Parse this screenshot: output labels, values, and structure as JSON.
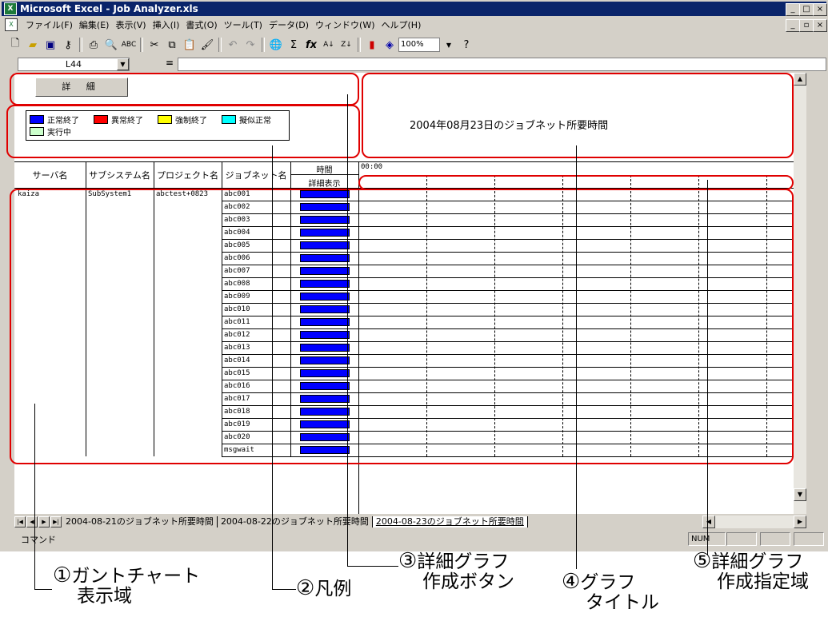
{
  "window": {
    "title": "Microsoft Excel - Job Analyzer.xls",
    "app_icon": "excel-icon",
    "doc_icon": "worksheet-icon"
  },
  "menu": [
    "ファイル(F)",
    "編集(E)",
    "表示(V)",
    "挿入(I)",
    "書式(O)",
    "ツール(T)",
    "データ(D)",
    "ウィンドウ(W)",
    "ヘルプ(H)"
  ],
  "toolbar": {
    "zoom": "100%"
  },
  "formula_bar": {
    "name_box": "L44",
    "equals": "="
  },
  "sheet": {
    "detail_button": "詳 細",
    "legend": [
      {
        "label": "正常終了",
        "color": "#0000ff"
      },
      {
        "label": "異常終了",
        "color": "#ff0000"
      },
      {
        "label": "強制終了",
        "color": "#ffff00"
      },
      {
        "label": "擬似正常",
        "color": "#00ffff"
      },
      {
        "label": "実行中",
        "color": "#ccffcc"
      }
    ],
    "graph_title": "2004年08月23日のジョブネット所要時間",
    "headers": {
      "server": "サーバ名",
      "subsystem": "サブシステム名",
      "project": "プロジェクト名",
      "jobnet": "ジョブネット名",
      "time": "時間",
      "detail": "詳細表示",
      "timeline_start": "00:00"
    },
    "server": "kaiza",
    "subsystem": "SubSystem1",
    "project": "abctest+0823",
    "jobnets": [
      "abc001",
      "abc002",
      "abc003",
      "abc004",
      "abc005",
      "abc006",
      "abc007",
      "abc008",
      "abc009",
      "abc010",
      "abc011",
      "abc012",
      "abc013",
      "abc014",
      "abc015",
      "abc016",
      "abc017",
      "abc018",
      "abc019",
      "abc020",
      "msgwait"
    ]
  },
  "tabs": [
    "2004-08-21のジョブネット所要時間",
    "2004-08-22のジョブネット所要時間",
    "2004-08-23のジョブネット所要時間"
  ],
  "active_tab": 2,
  "status": {
    "left": "コマンド",
    "num": "NUM"
  },
  "annotations": [
    {
      "num": "①",
      "line1": "ガントチャート",
      "line2": "表示域"
    },
    {
      "num": "②",
      "line1": "凡例",
      "line2": ""
    },
    {
      "num": "③",
      "line1": "詳細グラフ",
      "line2": "作成ボタン"
    },
    {
      "num": "④",
      "line1": "グラフ",
      "line2": "タイトル"
    },
    {
      "num": "⑤",
      "line1": "詳細グラフ",
      "line2": "作成指定域"
    }
  ]
}
